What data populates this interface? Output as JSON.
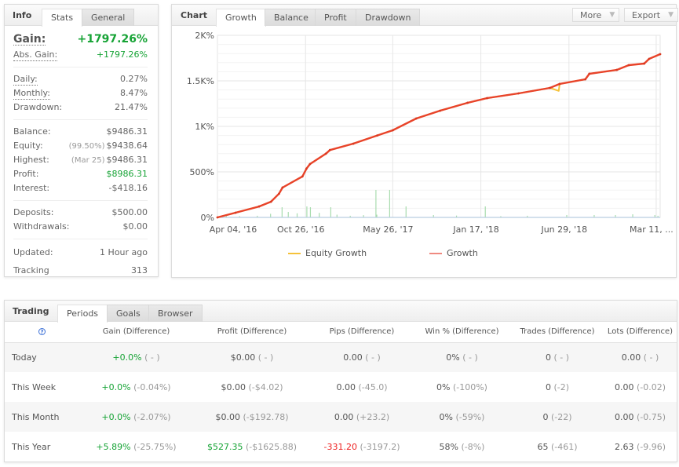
{
  "info": {
    "title": "Info",
    "tabs": [
      {
        "label": "Stats",
        "active": true
      },
      {
        "label": "General",
        "active": false
      }
    ],
    "gain": {
      "label": "Gain:",
      "value": "+1797.26%"
    },
    "abs_gain": {
      "label": "Abs. Gain:",
      "value": "+1797.26%"
    },
    "daily": {
      "label": "Daily:",
      "value": "0.27%"
    },
    "monthly": {
      "label": "Monthly:",
      "value": "8.47%"
    },
    "drawdown": {
      "label": "Drawdown:",
      "value": "21.47%"
    },
    "balance": {
      "label": "Balance:",
      "value": "$9486.31"
    },
    "equity": {
      "label": "Equity:",
      "sub": "(99.50%)",
      "value": "$9438.64"
    },
    "highest": {
      "label": "Highest:",
      "sub": "(Mar 25)",
      "value": "$9486.31"
    },
    "profit": {
      "label": "Profit:",
      "value": "$8986.31"
    },
    "interest": {
      "label": "Interest:",
      "value": "-$418.16"
    },
    "deposits": {
      "label": "Deposits:",
      "value": "$500.00"
    },
    "withdrawals": {
      "label": "Withdrawals:",
      "value": "$0.00"
    },
    "updated": {
      "label": "Updated:",
      "value": "1 Hour ago"
    },
    "tracking": {
      "label": "Tracking",
      "value": "313"
    }
  },
  "chart_panel": {
    "title": "Chart",
    "tabs": [
      {
        "label": "Growth",
        "active": true
      },
      {
        "label": "Balance",
        "active": false
      },
      {
        "label": "Profit",
        "active": false
      },
      {
        "label": "Drawdown",
        "active": false
      }
    ],
    "more_label": "More",
    "export_label": "Export",
    "caret": "▼"
  },
  "chart_data": {
    "type": "line",
    "title": "",
    "xlabel": "",
    "ylabel": "",
    "ylim": [
      0,
      2000
    ],
    "xlim": [
      0,
      100
    ],
    "grid": true,
    "legend_position": "bottom",
    "y_ticks": [
      {
        "value": 0,
        "label": "0%"
      },
      {
        "value": 500,
        "label": "500%"
      },
      {
        "value": 1000,
        "label": "1K%"
      },
      {
        "value": 1500,
        "label": "1.5K%"
      },
      {
        "value": 2000,
        "label": "2K%"
      }
    ],
    "x_ticks": [
      {
        "value": 0,
        "label": "Apr 04, '16"
      },
      {
        "value": 19.9,
        "label": "Oct 26, '16"
      },
      {
        "value": 39.6,
        "label": "May 26, '17"
      },
      {
        "value": 59.5,
        "label": "Jan 17, '18"
      },
      {
        "value": 79.4,
        "label": "Jun 29, '18"
      },
      {
        "value": 99.1,
        "label": "Mar 11, ..."
      }
    ],
    "series": [
      {
        "name": "Growth",
        "color": "#e8432a",
        "points": [
          [
            0,
            0
          ],
          [
            4.1,
            52
          ],
          [
            9.4,
            120
          ],
          [
            12.1,
            172
          ],
          [
            13.9,
            260
          ],
          [
            14.7,
            328
          ],
          [
            19.2,
            450
          ],
          [
            20.1,
            535
          ],
          [
            20.9,
            586
          ],
          [
            24.5,
            700
          ],
          [
            25.4,
            740
          ],
          [
            30.7,
            810
          ],
          [
            36.1,
            900
          ],
          [
            39.6,
            957
          ],
          [
            44.9,
            1086
          ],
          [
            50.3,
            1172
          ],
          [
            56.5,
            1259
          ],
          [
            60.9,
            1310
          ],
          [
            68,
            1362
          ],
          [
            75.1,
            1422
          ],
          [
            77.3,
            1466
          ],
          [
            83.1,
            1517
          ],
          [
            84,
            1578
          ],
          [
            90.2,
            1620
          ],
          [
            92.9,
            1672
          ],
          [
            96.4,
            1690
          ],
          [
            97.5,
            1741
          ],
          [
            100,
            1793
          ]
        ]
      },
      {
        "name": "Equity Growth",
        "color": "#f5c23a",
        "points": [
          [
            0,
            0
          ],
          [
            4.1,
            52
          ],
          [
            9.4,
            120
          ],
          [
            12.1,
            172
          ],
          [
            13.9,
            260
          ],
          [
            14.7,
            328
          ],
          [
            19.2,
            450
          ],
          [
            20.1,
            535
          ],
          [
            20.9,
            586
          ],
          [
            24.5,
            700
          ],
          [
            25.4,
            740
          ],
          [
            30.7,
            810
          ],
          [
            36.1,
            900
          ],
          [
            39.6,
            957
          ],
          [
            44.9,
            1086
          ],
          [
            50.3,
            1172
          ],
          [
            56.5,
            1259
          ],
          [
            60.9,
            1310
          ],
          [
            68,
            1362
          ],
          [
            75.1,
            1422
          ],
          [
            77.1,
            1390
          ],
          [
            77.3,
            1466
          ],
          [
            83.1,
            1517
          ],
          [
            84,
            1578
          ],
          [
            90.2,
            1620
          ],
          [
            92.9,
            1672
          ],
          [
            96.4,
            1690
          ],
          [
            97.5,
            1741
          ],
          [
            100,
            1793
          ]
        ]
      },
      {
        "name": "Drawdown spikes",
        "color": "#a8dcae",
        "type": "bar",
        "points": [
          [
            2,
            20
          ],
          [
            5,
            14
          ],
          [
            9,
            18
          ],
          [
            12,
            40
          ],
          [
            14.6,
            112
          ],
          [
            16,
            60
          ],
          [
            18,
            45
          ],
          [
            20.2,
            121
          ],
          [
            21,
            112
          ],
          [
            23,
            50
          ],
          [
            25.6,
            112
          ],
          [
            27,
            30
          ],
          [
            30,
            18
          ],
          [
            33,
            25
          ],
          [
            36,
            30
          ],
          [
            35.8,
            302
          ],
          [
            38.9,
            302
          ],
          [
            42.6,
            121
          ],
          [
            48.8,
            26
          ],
          [
            54,
            20
          ],
          [
            60.5,
            121
          ],
          [
            64,
            14
          ],
          [
            70,
            18
          ],
          [
            78.9,
            26
          ],
          [
            85.1,
            26
          ],
          [
            89.9,
            26
          ],
          [
            93.8,
            34
          ],
          [
            98.8,
            26
          ],
          [
            99.5,
            18
          ]
        ]
      }
    ],
    "legend": [
      {
        "name": "Equity Growth",
        "color": "#f5c23a"
      },
      {
        "name": "Growth",
        "color": "#e8432a"
      }
    ]
  },
  "trading": {
    "title": "Trading",
    "tabs": [
      {
        "label": "Periods",
        "active": true
      },
      {
        "label": "Goals",
        "active": false
      },
      {
        "label": "Browser",
        "active": false
      }
    ],
    "help_icon": "?",
    "columns": [
      "Gain (Difference)",
      "Profit (Difference)",
      "Pips (Difference)",
      "Win % (Difference)",
      "Trades (Difference)",
      "Lots (Difference)"
    ],
    "rows": [
      {
        "period": "Today",
        "cells": [
          {
            "value": "+0.0%",
            "diff": "( - )",
            "tone": "green"
          },
          {
            "value": "$0.00",
            "diff": "( - )",
            "tone": ""
          },
          {
            "value": "0.00",
            "diff": "( - )",
            "tone": ""
          },
          {
            "value": "0%",
            "diff": "( - )",
            "tone": ""
          },
          {
            "value": "0",
            "diff": "( - )",
            "tone": ""
          },
          {
            "value": "0.00",
            "diff": "( - )",
            "tone": ""
          }
        ]
      },
      {
        "period": "This Week",
        "cells": [
          {
            "value": "+0.0%",
            "diff": "(-0.04%)",
            "tone": "green"
          },
          {
            "value": "$0.00",
            "diff": "(-$4.02)",
            "tone": ""
          },
          {
            "value": "0.00",
            "diff": "(-45.0)",
            "tone": ""
          },
          {
            "value": "0%",
            "diff": "(-100%)",
            "tone": ""
          },
          {
            "value": "0",
            "diff": "(-2)",
            "tone": ""
          },
          {
            "value": "0.00",
            "diff": "(-0.02)",
            "tone": ""
          }
        ]
      },
      {
        "period": "This Month",
        "cells": [
          {
            "value": "+0.0%",
            "diff": "(-2.07%)",
            "tone": "green"
          },
          {
            "value": "$0.00",
            "diff": "(-$192.78)",
            "tone": ""
          },
          {
            "value": "0.00",
            "diff": "(+23.2)",
            "tone": ""
          },
          {
            "value": "0%",
            "diff": "(-59%)",
            "tone": ""
          },
          {
            "value": "0",
            "diff": "(-22)",
            "tone": ""
          },
          {
            "value": "0.00",
            "diff": "(-0.75)",
            "tone": ""
          }
        ]
      },
      {
        "period": "This Year",
        "cells": [
          {
            "value": "+5.89%",
            "diff": "(-25.75%)",
            "tone": "green"
          },
          {
            "value": "$527.35",
            "diff": "(-$1625.88)",
            "tone": "green"
          },
          {
            "value": "-331.20",
            "diff": "(-3197.2)",
            "tone": "red"
          },
          {
            "value": "58%",
            "diff": "(-8%)",
            "tone": ""
          },
          {
            "value": "65",
            "diff": "(-461)",
            "tone": ""
          },
          {
            "value": "2.63",
            "diff": "(-9.96)",
            "tone": ""
          }
        ]
      }
    ]
  }
}
